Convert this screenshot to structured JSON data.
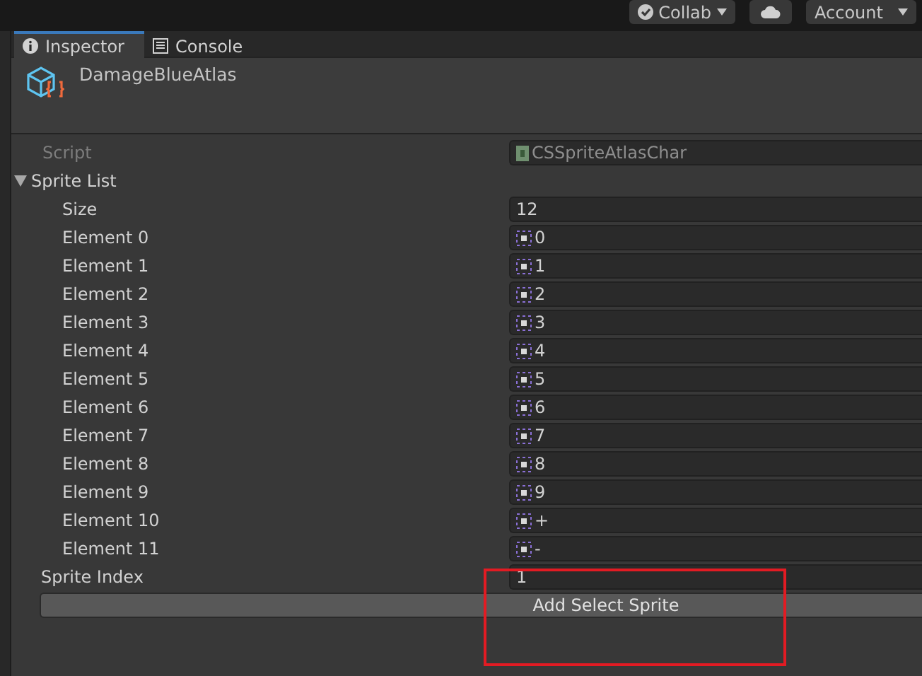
{
  "toolbar": {
    "collab": "Collab",
    "account": "Account"
  },
  "tabs": [
    {
      "label": "Inspector",
      "selected": true
    },
    {
      "label": "Console",
      "selected": false
    }
  ],
  "header": {
    "title": "DamageBlueAtlas"
  },
  "script": {
    "label": "Script",
    "value": "CSSpriteAtlasChar",
    "disabled": true
  },
  "sprite_list": {
    "label": "Sprite List",
    "expanded": true,
    "size_label": "Size",
    "size": "12",
    "elements": [
      {
        "label": "Element 0",
        "value": "0"
      },
      {
        "label": "Element 1",
        "value": "1"
      },
      {
        "label": "Element 2",
        "value": "2"
      },
      {
        "label": "Element 3",
        "value": "3"
      },
      {
        "label": "Element 4",
        "value": "4"
      },
      {
        "label": "Element 5",
        "value": "5"
      },
      {
        "label": "Element 6",
        "value": "6"
      },
      {
        "label": "Element 7",
        "value": "7"
      },
      {
        "label": "Element 8",
        "value": "8"
      },
      {
        "label": "Element 9",
        "value": "9"
      },
      {
        "label": "Element 10",
        "value": "+"
      },
      {
        "label": "Element 11",
        "value": "-"
      }
    ]
  },
  "sprite_index": {
    "label": "Sprite Index",
    "value": "1"
  },
  "button": "Add Select Sprite"
}
